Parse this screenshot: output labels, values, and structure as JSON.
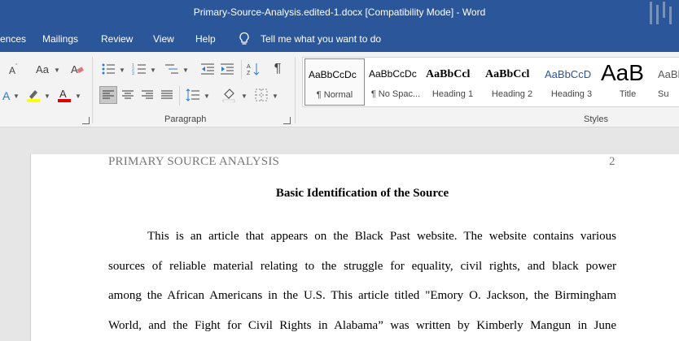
{
  "window": {
    "title": "Primary-Source-Analysis.edited-1.docx [Compatibility Mode]  -  Word"
  },
  "menu": {
    "items": [
      "ences",
      "Mailings",
      "Review",
      "View",
      "Help"
    ],
    "tell_me": "Tell me what you want to do"
  },
  "ribbon": {
    "font_size_label": "Aa",
    "pilcrow": "¶",
    "paragraph_group_label": "Paragraph",
    "styles_group_label": "Styles",
    "styles": [
      {
        "preview": "AaBbCcDc",
        "name": "¶ Normal",
        "selected": true
      },
      {
        "preview": "AaBbCcDc",
        "name": "¶ No Spac...",
        "selected": false
      },
      {
        "preview": "AaBbCcl",
        "name": "Heading 1",
        "selected": false
      },
      {
        "preview": "AaBbCcl",
        "name": "Heading 2",
        "selected": false
      },
      {
        "preview": "AaBbCcD",
        "name": "Heading 3",
        "selected": false
      },
      {
        "preview": "AaB",
        "name": "Title",
        "selected": false
      },
      {
        "preview": "AaBl",
        "name": "Su",
        "selected": false
      }
    ],
    "colors": {
      "highlight": "#ffff00",
      "font_color": "#e00000"
    }
  },
  "document": {
    "header": "PRIMARY SOURCE ANALYSIS",
    "page_number": "2",
    "heading": "Basic Identification of the Source",
    "lines": [
      "This is an article that appears on the Black Past website. The website contains various",
      "sources of reliable material relating to the struggle for equality, civil rights, and black power",
      "among the African Americans in the U.S. This article titled \"Emory O. Jackson, the Birmingham",
      "World, and the Fight for Civil Rights in Alabama” was written by Kimberly Mangun in June"
    ]
  }
}
